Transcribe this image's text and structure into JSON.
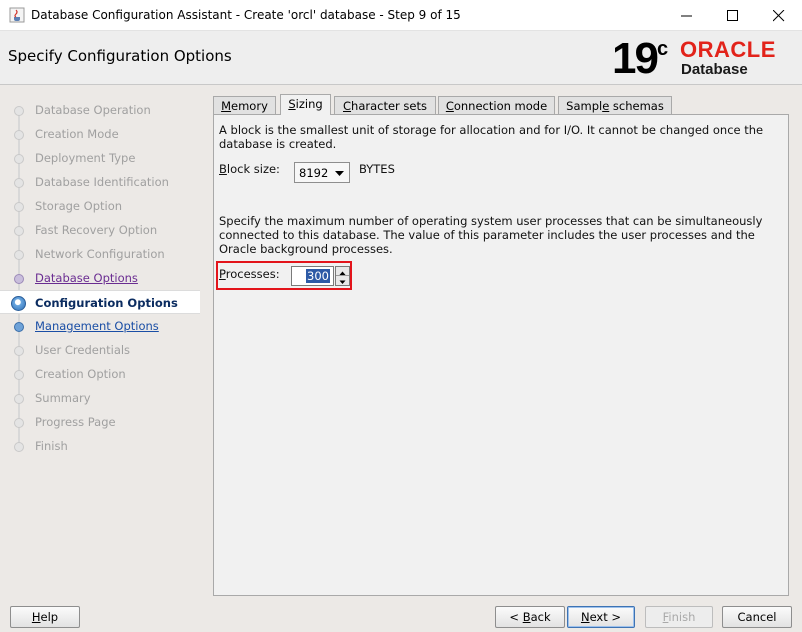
{
  "window": {
    "title": "Database Configuration Assistant - Create 'orcl' database - Step 9 of 15",
    "icon": "java-cup-icon"
  },
  "header": {
    "page_title": "Specify Configuration Options",
    "brand_version": "19",
    "brand_version_sup": "c",
    "brand_name": "ORACLE",
    "brand_product": "Database",
    "brand_color": "#e2231a"
  },
  "nav": {
    "items": [
      {
        "label": "Database Operation",
        "state": "disabled"
      },
      {
        "label": "Creation Mode",
        "state": "disabled"
      },
      {
        "label": "Deployment Type",
        "state": "disabled"
      },
      {
        "label": "Database Identification",
        "state": "disabled"
      },
      {
        "label": "Storage Option",
        "state": "disabled"
      },
      {
        "label": "Fast Recovery Option",
        "state": "disabled"
      },
      {
        "label": "Network Configuration",
        "state": "disabled"
      },
      {
        "label": "Database Options",
        "state": "visited"
      },
      {
        "label": "Configuration Options",
        "state": "current"
      },
      {
        "label": "Management Options",
        "state": "link"
      },
      {
        "label": "User Credentials",
        "state": "disabled"
      },
      {
        "label": "Creation Option",
        "state": "disabled"
      },
      {
        "label": "Summary",
        "state": "disabled"
      },
      {
        "label": "Progress Page",
        "state": "disabled"
      },
      {
        "label": "Finish",
        "state": "disabled"
      }
    ]
  },
  "tabs": [
    {
      "label": "Memory",
      "mnemonic": "M",
      "rest": "emory",
      "active": false
    },
    {
      "label": "Sizing",
      "mnemonic": "S",
      "rest": "izing",
      "active": true
    },
    {
      "label": "Character sets",
      "mnemonic": "C",
      "rest": "haracter sets",
      "active": false
    },
    {
      "label": "Connection mode",
      "mnemonic": "C",
      "rest": "onnection mode",
      "active": false
    },
    {
      "label": "Sample schemas",
      "pre": "Sampl",
      "mnemonic": "e",
      "rest": " schemas",
      "active": false
    }
  ],
  "sizing": {
    "block_desc_line1": "A block is the smallest unit of storage for allocation and for I/O. It cannot be changed once the",
    "block_desc_line2": "database is created.",
    "block_size_label_mn": "B",
    "block_size_label_rest": "lock size:",
    "block_size_value": "8192",
    "block_size_unit": "BYTES",
    "proc_desc_line1": "Specify the maximum number of operating system user processes that can be simultaneously",
    "proc_desc_line2": "connected to this database. The value of this parameter includes the user processes and the",
    "proc_desc_line3": "Oracle background processes.",
    "processes_label_mn": "P",
    "processes_label_rest": "rocesses:",
    "processes_value": "300",
    "highlight_color": "#e3141b"
  },
  "footer": {
    "help_mn": "H",
    "help_rest": "elp",
    "back_pre": "< ",
    "back_mn": "B",
    "back_rest": "ack",
    "next_mn": "N",
    "next_rest": "ext >",
    "finish_mn": "F",
    "finish_rest": "inish",
    "cancel_label": "Cancel"
  }
}
